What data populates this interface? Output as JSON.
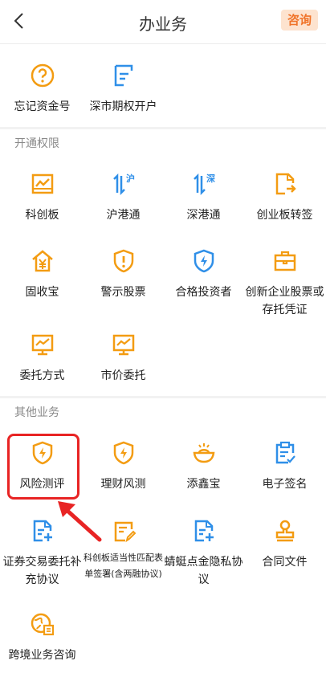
{
  "header": {
    "title": "办业务",
    "consult_label": "咨询"
  },
  "top_items": [
    {
      "label": "忘记资金号",
      "icon": "question-circle-icon"
    },
    {
      "label": "深市期权开户",
      "icon": "document-list-icon"
    }
  ],
  "section_open": {
    "title": "开通权限"
  },
  "open_items": [
    {
      "label": "科创板",
      "icon": "board-chart-icon"
    },
    {
      "label": "沪港通",
      "icon": "shanghai-hk-connect-icon",
      "badge": "沪"
    },
    {
      "label": "深港通",
      "icon": "shenzhen-hk-connect-icon",
      "badge": "深"
    },
    {
      "label": "创业板转签",
      "icon": "document-transfer-icon"
    },
    {
      "label": "固收宝",
      "icon": "house-yuan-icon"
    },
    {
      "label": "警示股票",
      "icon": "warning-shield-icon"
    },
    {
      "label": "合格投资者",
      "icon": "lightning-shield-icon"
    },
    {
      "label": "创新企业股票或存托凭证",
      "icon": "briefcase-icon"
    },
    {
      "label": "委托方式",
      "icon": "monitor-chart-icon"
    },
    {
      "label": "市价委托",
      "icon": "monitor-chart-icon"
    }
  ],
  "section_other": {
    "title": "其他业务"
  },
  "other_items": [
    {
      "label": "风险测评",
      "icon": "lightning-shield-icon"
    },
    {
      "label": "理财风测",
      "icon": "lightning-shield-icon"
    },
    {
      "label": "添鑫宝",
      "icon": "gold-ingot-icon"
    },
    {
      "label": "电子签名",
      "icon": "clipboard-check-icon"
    },
    {
      "label": "证券交易委托补充协议",
      "icon": "document-plus-icon"
    },
    {
      "label": "科创板适当性匹配表单签署(含两融协议)",
      "icon": "document-edit-icon"
    },
    {
      "label": "蜻蜓点金隐私协议",
      "icon": "document-plus-icon"
    },
    {
      "label": "合同文件",
      "icon": "stamp-icon"
    },
    {
      "label": "跨境业务咨询",
      "icon": "globe-document-icon"
    }
  ],
  "colors": {
    "blue": "#2f8fe8",
    "orange": "#f39c12",
    "red_highlight": "#e82424",
    "consult_text": "#f0742a"
  }
}
